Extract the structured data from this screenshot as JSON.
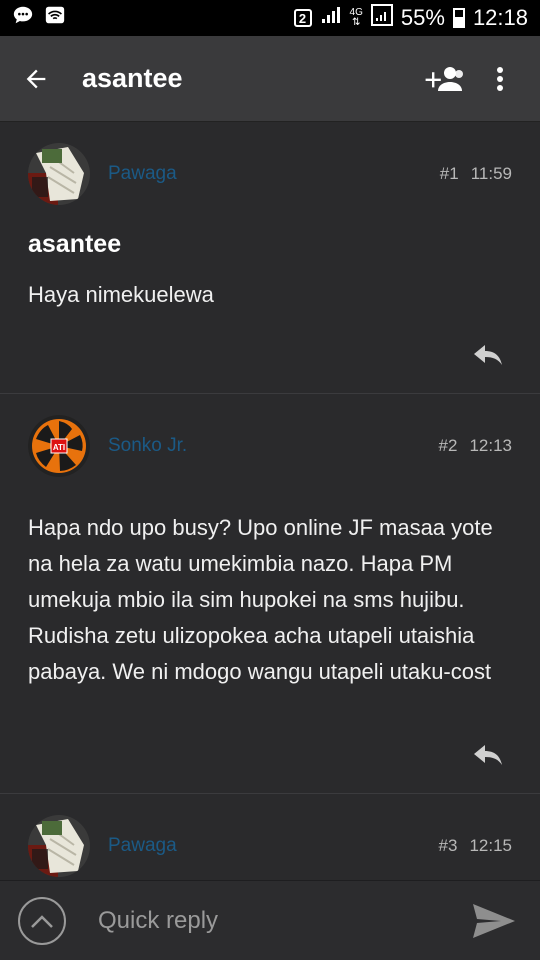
{
  "status_bar": {
    "left_icons": [
      "chat-icon",
      "wifi-icon"
    ],
    "sim_badge": "2",
    "network_label_top": "4G",
    "battery": "55%",
    "time": "12:18"
  },
  "app_bar": {
    "title": "asantee",
    "back_icon": "arrow-left-icon",
    "actions": [
      "add-user-icon",
      "more-vert-icon"
    ]
  },
  "posts": [
    {
      "author": "Pawaga",
      "number": "#1",
      "time": "11:59",
      "title": "asantee",
      "body": "Haya nimekuelewa"
    },
    {
      "author": "Sonko Jr.",
      "number": "#2",
      "time": "12:13",
      "body": "Hapa ndo upo busy? Upo online JF masaa yote na hela za watu umekimbia nazo. Hapa PM umekuja mbio ila sim hupokei na sms hujibu. Rudisha zetu ulizopokea acha utapeli utaishia pabaya. We ni mdogo wangu utapeli utaku-cost"
    },
    {
      "author": "Pawaga",
      "number": "#3",
      "time": "12:15"
    }
  ],
  "quick_reply": {
    "placeholder": "Quick reply"
  },
  "colors": {
    "background": "#2a2a2c",
    "app_bar": "#3a3a3c",
    "author_link": "#1b5a86"
  }
}
